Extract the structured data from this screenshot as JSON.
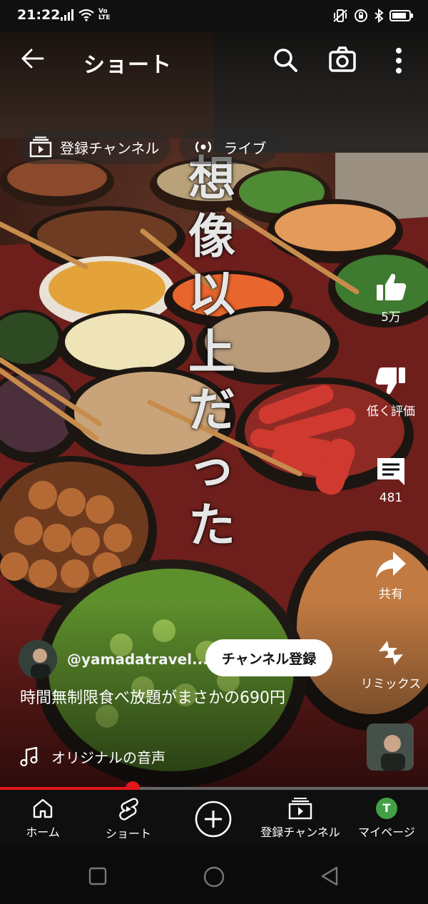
{
  "status_bar": {
    "time": "21:22",
    "network_label": "Vo\nLTE"
  },
  "header": {
    "title": "ショート"
  },
  "chips": [
    {
      "label": "登録チャンネル",
      "icon": "subscriptions-icon"
    },
    {
      "label": "ライブ",
      "icon": "live-icon"
    }
  ],
  "overlay_text": [
    "想",
    "像",
    "以",
    "上",
    "だ",
    "っ",
    "た"
  ],
  "actions": {
    "like": {
      "label": "5万",
      "icon": "thumbs-up-icon"
    },
    "dislike": {
      "label": "低く評価",
      "icon": "thumbs-down-icon"
    },
    "comments": {
      "label": "481",
      "icon": "comment-icon"
    },
    "share": {
      "label": "共有",
      "icon": "share-icon"
    },
    "remix": {
      "label": "リミックス",
      "icon": "remix-icon"
    }
  },
  "channel": {
    "name": "@yamadatravel...",
    "subscribe_label": "チャンネル登録"
  },
  "video": {
    "title": "時間無制限食べ放題がまさかの690円",
    "audio": "オリジナルの音声",
    "progress": 0.31
  },
  "bottom_nav": [
    {
      "label": "ホーム",
      "icon": "home-icon"
    },
    {
      "label": "ショート",
      "icon": "shorts-icon"
    },
    {
      "label": "",
      "icon": "create-icon"
    },
    {
      "label": "登録チャンネル",
      "icon": "subscriptions-icon"
    },
    {
      "label": "マイページ",
      "icon": "profile-avatar",
      "avatar_letter": "T"
    }
  ],
  "colors": {
    "accent_red": "#e3151d",
    "avatar_green": "#43a047"
  }
}
